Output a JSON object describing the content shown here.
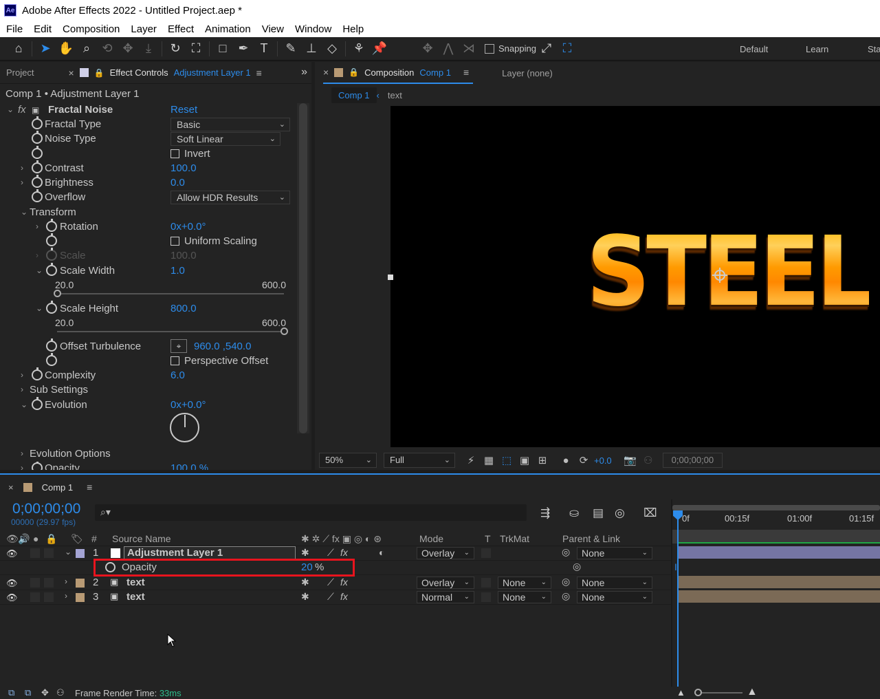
{
  "window": {
    "app_icon": "Ae",
    "title": "Adobe After Effects 2022 - Untitled Project.aep *"
  },
  "menu": [
    "File",
    "Edit",
    "Composition",
    "Layer",
    "Effect",
    "Animation",
    "View",
    "Window",
    "Help"
  ],
  "toolbar": {
    "snapping_label": "Snapping",
    "workspaces": [
      "Default",
      "Learn",
      "Sta"
    ],
    "icons": [
      "home-icon",
      "selection-tool-icon",
      "hand-tool-icon",
      "zoom-tool-icon",
      "orbit-icon",
      "pan-icon",
      "dolly-icon",
      "rotate-tool-icon",
      "pan-behind-icon",
      "rectangle-tool-icon",
      "pen-tool-icon",
      "type-tool-icon",
      "brush-tool-icon",
      "clone-stamp-icon",
      "eraser-icon",
      "roto-brush-icon",
      "puppet-pin-icon"
    ]
  },
  "left_panel": {
    "project_tab": "Project",
    "effect_controls_tab": "Effect Controls",
    "effect_controls_layer": "Adjustment Layer 1",
    "header": "Comp 1 • Adjustment Layer 1",
    "effect": {
      "fx": "fx",
      "name": "Fractal Noise",
      "reset": "Reset"
    },
    "props": {
      "fractal_type": {
        "label": "Fractal Type",
        "value": "Basic"
      },
      "noise_type": {
        "label": "Noise Type",
        "value": "Soft Linear"
      },
      "invert": {
        "label": "Invert",
        "checked": false
      },
      "contrast": {
        "label": "Contrast",
        "value": "100.0"
      },
      "brightness": {
        "label": "Brightness",
        "value": "0.0"
      },
      "overflow": {
        "label": "Overflow",
        "value": "Allow HDR Results"
      },
      "transform": {
        "label": "Transform"
      },
      "rotation": {
        "label": "Rotation",
        "value": "0x+0.0°"
      },
      "uniform_scaling": {
        "label": "Uniform Scaling",
        "checked": false
      },
      "scale": {
        "label": "Scale",
        "value": "100.0"
      },
      "scale_width": {
        "label": "Scale Width",
        "value": "1.0",
        "min": "20.0",
        "max": "600.0",
        "position": 0.0
      },
      "scale_height": {
        "label": "Scale Height",
        "value": "800.0",
        "min": "20.0",
        "max": "600.0",
        "position": 1.0
      },
      "offset_turbulence": {
        "label": "Offset Turbulence",
        "value": "960.0 ,540.0"
      },
      "perspective_offset": {
        "label": "Perspective Offset",
        "checked": false
      },
      "complexity": {
        "label": "Complexity",
        "value": "6.0"
      },
      "sub_settings": {
        "label": "Sub Settings"
      },
      "evolution": {
        "label": "Evolution",
        "value": "0x+0.0°"
      },
      "evolution_options": {
        "label": "Evolution Options"
      },
      "opacity": {
        "label": "Opacity",
        "value": "100.0 %"
      }
    }
  },
  "comp_panel": {
    "tab_label": "Composition",
    "tab_comp": "Comp 1",
    "layer_tab": "Layer (none)",
    "subtabs": [
      "Comp 1",
      "text"
    ],
    "viewer_text": "STEEL",
    "footer": {
      "zoom": "50%",
      "resolution": "Full",
      "exposure": "+0.0",
      "timecode": "0;00;00;00"
    }
  },
  "timeline": {
    "tab": "Comp 1",
    "timecode": "0;00;00;00",
    "frames": "00000 (29.97 fps)",
    "columns": {
      "hash": "#",
      "source_name": "Source Name",
      "mode": "Mode",
      "t": "T",
      "trkmat": "TrkMat",
      "parent": "Parent & Link"
    },
    "ruler": [
      "0f",
      "00:15f",
      "01:00f",
      "01:15f"
    ],
    "layers": [
      {
        "num": "1",
        "name": "Adjustment Layer 1",
        "mode": "Overlay",
        "trkmat": "",
        "parent": "None",
        "color": "#a4a4d4",
        "bar": "#7575a3"
      },
      {
        "num": "2",
        "name": "text",
        "mode": "Overlay",
        "trkmat": "None",
        "parent": "None",
        "color": "#b89a74",
        "bar": "#7b6a56"
      },
      {
        "num": "3",
        "name": "text",
        "mode": "Normal",
        "trkmat": "None",
        "parent": "None",
        "color": "#b89a74",
        "bar": "#7b6a56"
      }
    ],
    "opacity_row": {
      "label": "Opacity",
      "value": "20",
      "unit": "%"
    }
  },
  "status": {
    "label": "Frame Render Time:",
    "value": "33ms"
  },
  "colors": {
    "accent": "#2d8ceb",
    "highlight": "#e8141e",
    "panel": "#232323"
  }
}
